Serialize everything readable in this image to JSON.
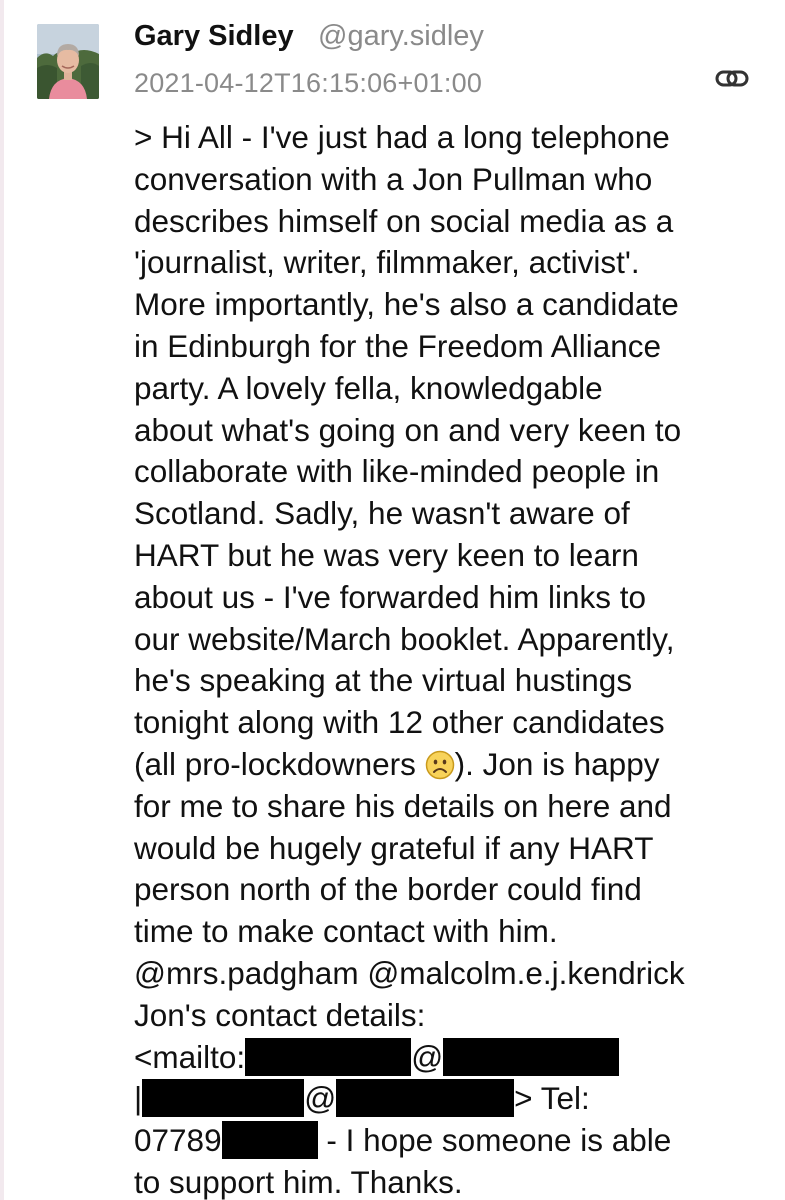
{
  "author": {
    "name": "Gary Sidley",
    "handle": "@gary.sidley",
    "timestamp": "2021-04-12T16:15:06+01:00"
  },
  "icons": {
    "avatar": "user-avatar-photo",
    "permalink": "link-icon",
    "emoji": "frowning-face-emoji"
  },
  "post": {
    "lines": [
      "> Hi All - I've just had a long telephone",
      "conversation with a Jon Pullman who",
      "describes himself on social media as a",
      "'journalist, writer, filmmaker, activist'.",
      "More importantly, he's also a candidate",
      "in Edinburgh for the Freedom Alliance",
      "party. A lovely fella, knowledgable",
      "about what's going on and very keen to",
      "collaborate with like-minded people in",
      "Scotland.  Sadly, he wasn't aware of",
      "HART but he was very keen to learn",
      "about us - I've forwarded him links to",
      "our website/March booklet. Apparently,",
      "he's speaking at the virtual hustings",
      "tonight along with 12 other candidates"
    ],
    "line16_before_emoji": "(all pro-lockdowners ",
    "line16_after_emoji": "). Jon is happy",
    "lines_after_emoji": [
      "for me to share his details on here and",
      "would be hugely grateful if any HART",
      "person north of the border could find",
      "time to make contact with him."
    ],
    "mention_1": "@mrs.padgham",
    "mention_2": "@malcolm.e.j.kendrick",
    "contact_heading": "Jon's contact details:",
    "mailto_prefix": "<mailto:",
    "at_sign": "@",
    "pipe": "|",
    "tel_label": "> Tel:",
    "phone_prefix": "07789",
    "closing_1": " - I hope someone is able",
    "closing_2": "to support him. Thanks."
  },
  "colors": {
    "text": "#111111",
    "muted": "#8a8a8a",
    "redaction": "#000000"
  }
}
